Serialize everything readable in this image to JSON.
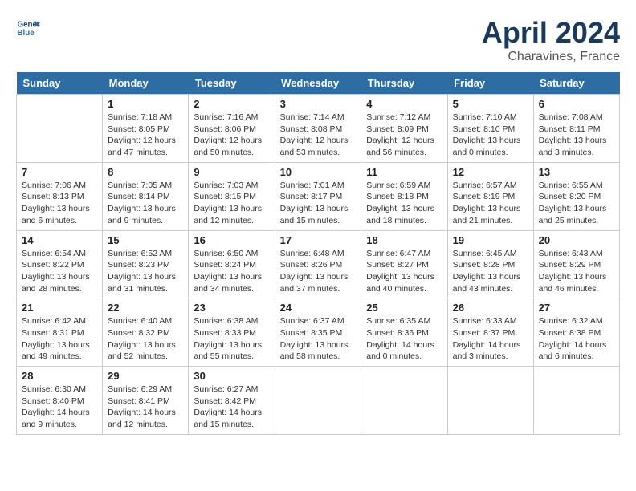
{
  "header": {
    "logo_line1": "General",
    "logo_line2": "Blue",
    "month": "April 2024",
    "location": "Charavines, France"
  },
  "weekdays": [
    "Sunday",
    "Monday",
    "Tuesday",
    "Wednesday",
    "Thursday",
    "Friday",
    "Saturday"
  ],
  "weeks": [
    [
      {
        "day": "",
        "sunrise": "",
        "sunset": "",
        "daylight": ""
      },
      {
        "day": "1",
        "sunrise": "Sunrise: 7:18 AM",
        "sunset": "Sunset: 8:05 PM",
        "daylight": "Daylight: 12 hours and 47 minutes."
      },
      {
        "day": "2",
        "sunrise": "Sunrise: 7:16 AM",
        "sunset": "Sunset: 8:06 PM",
        "daylight": "Daylight: 12 hours and 50 minutes."
      },
      {
        "day": "3",
        "sunrise": "Sunrise: 7:14 AM",
        "sunset": "Sunset: 8:08 PM",
        "daylight": "Daylight: 12 hours and 53 minutes."
      },
      {
        "day": "4",
        "sunrise": "Sunrise: 7:12 AM",
        "sunset": "Sunset: 8:09 PM",
        "daylight": "Daylight: 12 hours and 56 minutes."
      },
      {
        "day": "5",
        "sunrise": "Sunrise: 7:10 AM",
        "sunset": "Sunset: 8:10 PM",
        "daylight": "Daylight: 13 hours and 0 minutes."
      },
      {
        "day": "6",
        "sunrise": "Sunrise: 7:08 AM",
        "sunset": "Sunset: 8:11 PM",
        "daylight": "Daylight: 13 hours and 3 minutes."
      }
    ],
    [
      {
        "day": "7",
        "sunrise": "Sunrise: 7:06 AM",
        "sunset": "Sunset: 8:13 PM",
        "daylight": "Daylight: 13 hours and 6 minutes."
      },
      {
        "day": "8",
        "sunrise": "Sunrise: 7:05 AM",
        "sunset": "Sunset: 8:14 PM",
        "daylight": "Daylight: 13 hours and 9 minutes."
      },
      {
        "day": "9",
        "sunrise": "Sunrise: 7:03 AM",
        "sunset": "Sunset: 8:15 PM",
        "daylight": "Daylight: 13 hours and 12 minutes."
      },
      {
        "day": "10",
        "sunrise": "Sunrise: 7:01 AM",
        "sunset": "Sunset: 8:17 PM",
        "daylight": "Daylight: 13 hours and 15 minutes."
      },
      {
        "day": "11",
        "sunrise": "Sunrise: 6:59 AM",
        "sunset": "Sunset: 8:18 PM",
        "daylight": "Daylight: 13 hours and 18 minutes."
      },
      {
        "day": "12",
        "sunrise": "Sunrise: 6:57 AM",
        "sunset": "Sunset: 8:19 PM",
        "daylight": "Daylight: 13 hours and 21 minutes."
      },
      {
        "day": "13",
        "sunrise": "Sunrise: 6:55 AM",
        "sunset": "Sunset: 8:20 PM",
        "daylight": "Daylight: 13 hours and 25 minutes."
      }
    ],
    [
      {
        "day": "14",
        "sunrise": "Sunrise: 6:54 AM",
        "sunset": "Sunset: 8:22 PM",
        "daylight": "Daylight: 13 hours and 28 minutes."
      },
      {
        "day": "15",
        "sunrise": "Sunrise: 6:52 AM",
        "sunset": "Sunset: 8:23 PM",
        "daylight": "Daylight: 13 hours and 31 minutes."
      },
      {
        "day": "16",
        "sunrise": "Sunrise: 6:50 AM",
        "sunset": "Sunset: 8:24 PM",
        "daylight": "Daylight: 13 hours and 34 minutes."
      },
      {
        "day": "17",
        "sunrise": "Sunrise: 6:48 AM",
        "sunset": "Sunset: 8:26 PM",
        "daylight": "Daylight: 13 hours and 37 minutes."
      },
      {
        "day": "18",
        "sunrise": "Sunrise: 6:47 AM",
        "sunset": "Sunset: 8:27 PM",
        "daylight": "Daylight: 13 hours and 40 minutes."
      },
      {
        "day": "19",
        "sunrise": "Sunrise: 6:45 AM",
        "sunset": "Sunset: 8:28 PM",
        "daylight": "Daylight: 13 hours and 43 minutes."
      },
      {
        "day": "20",
        "sunrise": "Sunrise: 6:43 AM",
        "sunset": "Sunset: 8:29 PM",
        "daylight": "Daylight: 13 hours and 46 minutes."
      }
    ],
    [
      {
        "day": "21",
        "sunrise": "Sunrise: 6:42 AM",
        "sunset": "Sunset: 8:31 PM",
        "daylight": "Daylight: 13 hours and 49 minutes."
      },
      {
        "day": "22",
        "sunrise": "Sunrise: 6:40 AM",
        "sunset": "Sunset: 8:32 PM",
        "daylight": "Daylight: 13 hours and 52 minutes."
      },
      {
        "day": "23",
        "sunrise": "Sunrise: 6:38 AM",
        "sunset": "Sunset: 8:33 PM",
        "daylight": "Daylight: 13 hours and 55 minutes."
      },
      {
        "day": "24",
        "sunrise": "Sunrise: 6:37 AM",
        "sunset": "Sunset: 8:35 PM",
        "daylight": "Daylight: 13 hours and 58 minutes."
      },
      {
        "day": "25",
        "sunrise": "Sunrise: 6:35 AM",
        "sunset": "Sunset: 8:36 PM",
        "daylight": "Daylight: 14 hours and 0 minutes."
      },
      {
        "day": "26",
        "sunrise": "Sunrise: 6:33 AM",
        "sunset": "Sunset: 8:37 PM",
        "daylight": "Daylight: 14 hours and 3 minutes."
      },
      {
        "day": "27",
        "sunrise": "Sunrise: 6:32 AM",
        "sunset": "Sunset: 8:38 PM",
        "daylight": "Daylight: 14 hours and 6 minutes."
      }
    ],
    [
      {
        "day": "28",
        "sunrise": "Sunrise: 6:30 AM",
        "sunset": "Sunset: 8:40 PM",
        "daylight": "Daylight: 14 hours and 9 minutes."
      },
      {
        "day": "29",
        "sunrise": "Sunrise: 6:29 AM",
        "sunset": "Sunset: 8:41 PM",
        "daylight": "Daylight: 14 hours and 12 minutes."
      },
      {
        "day": "30",
        "sunrise": "Sunrise: 6:27 AM",
        "sunset": "Sunset: 8:42 PM",
        "daylight": "Daylight: 14 hours and 15 minutes."
      },
      {
        "day": "",
        "sunrise": "",
        "sunset": "",
        "daylight": ""
      },
      {
        "day": "",
        "sunrise": "",
        "sunset": "",
        "daylight": ""
      },
      {
        "day": "",
        "sunrise": "",
        "sunset": "",
        "daylight": ""
      },
      {
        "day": "",
        "sunrise": "",
        "sunset": "",
        "daylight": ""
      }
    ]
  ]
}
